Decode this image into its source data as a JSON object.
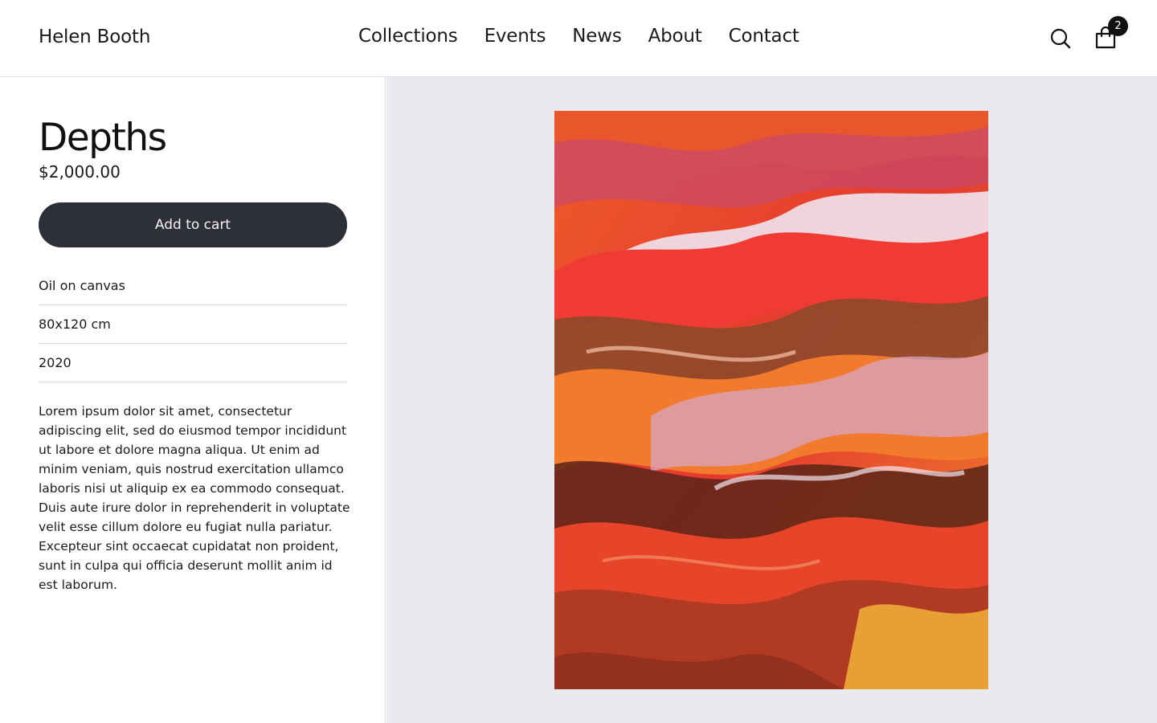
{
  "header": {
    "brand": "Helen Booth",
    "nav": [
      "Collections",
      "Events",
      "News",
      "About",
      "Contact"
    ],
    "cart_count": "2",
    "icons": {
      "search": "search-icon",
      "cart": "shopping-bag-icon"
    }
  },
  "product": {
    "title": "Depths",
    "price": "$2,000.00",
    "add_to_cart_label": "Add to cart",
    "specs": [
      "Oil on canvas",
      "80x120 cm",
      "2020"
    ],
    "description": "Lorem ipsum dolor sit amet, consectetur adipiscing elit, sed do eiusmod tempor incididunt ut labore et dolore magna aliqua. Ut enim ad minim veniam, quis nostrud exercitation ullamco laboris nisi ut aliquip ex ea commodo consequat. Duis aute irure dolor in reprehenderit in voluptate velit esse cillum dolore eu fugiat nulla pariatur. Excepteur sint occaecat cupidatat non proident, sunt in culpa qui officia deserunt mollit anim id est laborum."
  },
  "colors": {
    "button": "#2d3038",
    "image_background": "#e9eaee",
    "badge": "#111111"
  }
}
